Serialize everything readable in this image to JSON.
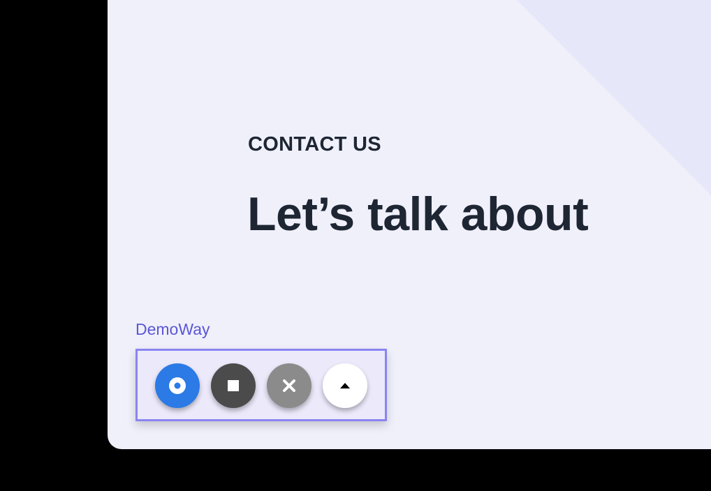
{
  "page": {
    "eyebrow": "CONTACT US",
    "headline": "Let’s talk about"
  },
  "widget": {
    "label": "DemoWay",
    "buttons": [
      {
        "name": "record",
        "icon": "record-icon",
        "color": "#2b7ae6"
      },
      {
        "name": "stop",
        "icon": "stop-icon",
        "color": "#4b4b4b"
      },
      {
        "name": "close",
        "icon": "close-icon",
        "color": "#8b8b8b"
      },
      {
        "name": "expand",
        "icon": "caret-up-icon",
        "color": "#ffffff"
      }
    ],
    "accent": "#8a84f0"
  },
  "colors": {
    "background": "#000000",
    "page": "#f0f0fb",
    "text": "#1e2633",
    "brand": "#5b57d6"
  }
}
